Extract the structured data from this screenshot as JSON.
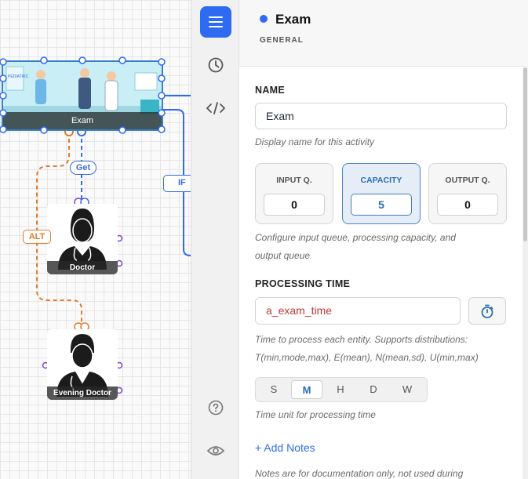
{
  "canvas": {
    "nodes": [
      {
        "id": "exam",
        "label": "Exam"
      },
      {
        "id": "doctor",
        "label": "Doctor"
      },
      {
        "id": "evening_doctor",
        "label": "Evening Doctor"
      }
    ],
    "edge_labels": {
      "get": "Get",
      "alt": "ALT",
      "if": "IF"
    },
    "exam_sign_text": "PEDIATRIC"
  },
  "rail": {
    "items": [
      {
        "name": "properties",
        "icon": "menu-icon",
        "active": true
      },
      {
        "name": "history",
        "icon": "clock-icon"
      },
      {
        "name": "code",
        "icon": "code-icon"
      },
      {
        "name": "help",
        "icon": "help-icon"
      },
      {
        "name": "visibility",
        "icon": "eye-icon"
      }
    ]
  },
  "panel": {
    "title": "Exam",
    "subtitle": "GENERAL",
    "name": {
      "label": "NAME",
      "value": "Exam",
      "help": "Display name for this activity"
    },
    "queues": [
      {
        "label": "INPUT Q.",
        "value": "0",
        "active": false
      },
      {
        "label": "CAPACITY",
        "value": "5",
        "active": true
      },
      {
        "label": "OUTPUT Q.",
        "value": "0",
        "active": false
      }
    ],
    "queue_help_line1": "Configure input queue, processing capacity, and",
    "queue_help_line2": "output queue",
    "processing_time": {
      "label": "PROCESSING TIME",
      "value": "a_exam_time",
      "help_line1": "Time to process each entity. Supports distributions:",
      "help_line2": "T(min,mode,max), E(mean), N(mean,sd), U(min,max)",
      "timer_icon": "stopwatch-icon"
    },
    "time_units": [
      "S",
      "M",
      "H",
      "D",
      "W"
    ],
    "selected_unit": "M",
    "time_unit_help": "Time unit for processing time",
    "add_notes": "+ Add Notes",
    "notes_help": "Notes are for documentation only, not used during"
  },
  "colors": {
    "accent": "#2f6bf0",
    "alt_edge": "#e07a2f",
    "get_edge": "#3c6ed8",
    "handle_purple": "#7a45d6",
    "processing_time_text": "#c03838"
  }
}
